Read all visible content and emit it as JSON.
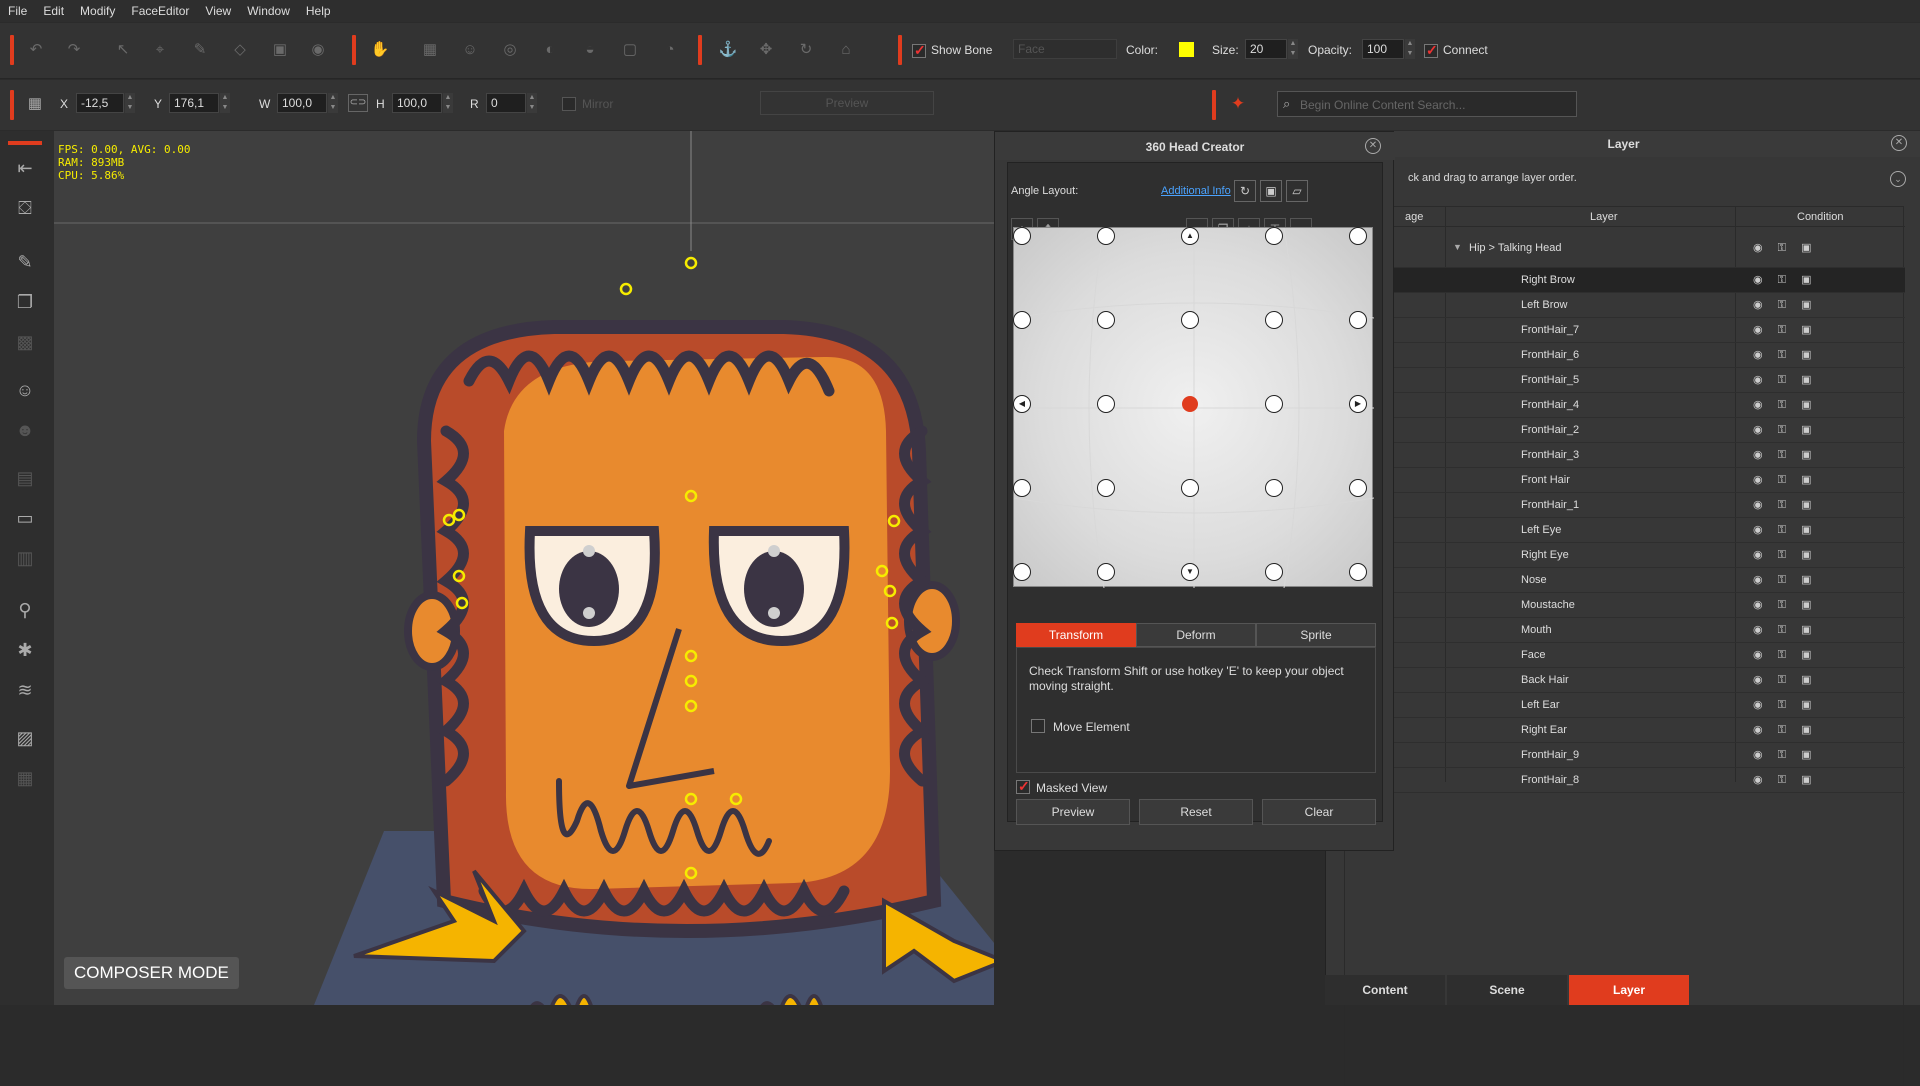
{
  "menu": [
    "File",
    "Edit",
    "Modify",
    "FaceEditor",
    "View",
    "Window",
    "Help"
  ],
  "toolbar1": {
    "show_bone_label": "Show Bone",
    "face_dropdown": "Face",
    "color_label": "Color:",
    "color_value": "#ffff00",
    "size_label": "Size:",
    "size_value": "20",
    "opacity_label": "Opacity:",
    "opacity_value": "100",
    "connect_label": "Connect"
  },
  "toolbar2": {
    "x_label": "X",
    "x_value": "-12,5",
    "y_label": "Y",
    "y_value": "176,1",
    "w_label": "W",
    "w_value": "100,0",
    "h_label": "H",
    "h_value": "100,0",
    "r_label": "R",
    "r_value": "0",
    "mirror_label": "Mirror",
    "preview_label": "Preview",
    "search_placeholder": "Begin Online Content Search..."
  },
  "viewport": {
    "fps": "FPS: 0.00, AVG: 0.00",
    "ram": "RAM: 893MB",
    "cpu": "CPU: 5.86%",
    "composer_mode": "COMPOSER MODE"
  },
  "head_creator": {
    "title": "360 Head Creator",
    "angle_layout": "Angle Layout:",
    "additional_info": "Additional Info",
    "tabs": [
      "Transform",
      "Deform",
      "Sprite"
    ],
    "hint": "Check Transform Shift or use hotkey 'E' to keep your object moving straight.",
    "move_element": "Move Element",
    "masked_view": "Masked View",
    "buttons": [
      "Preview",
      "Reset",
      "Clear"
    ]
  },
  "layer": {
    "title": "Layer",
    "hint": "ck and drag to arrange layer order.",
    "col_image": "age",
    "col_layer": "Layer",
    "col_condition": "Condition",
    "root": "Hip > Talking Head",
    "items": [
      "Right Brow",
      "Left Brow",
      "FrontHair_7",
      "FrontHair_6",
      "FrontHair_5",
      "FrontHair_4",
      "FrontHair_2",
      "FrontHair_3",
      "Front Hair",
      "FrontHair_1",
      "Left Eye",
      "Right Eye",
      "Nose",
      "Moustache",
      "Mouth",
      "Face",
      "Back Hair",
      "Left Ear",
      "Right Ear",
      "FrontHair_9",
      "FrontHair_8"
    ]
  },
  "bottom_tabs": [
    "Content",
    "Scene",
    "Layer"
  ],
  "colors": {
    "accent": "#e03c1e",
    "bone_point": "#ffff00"
  }
}
